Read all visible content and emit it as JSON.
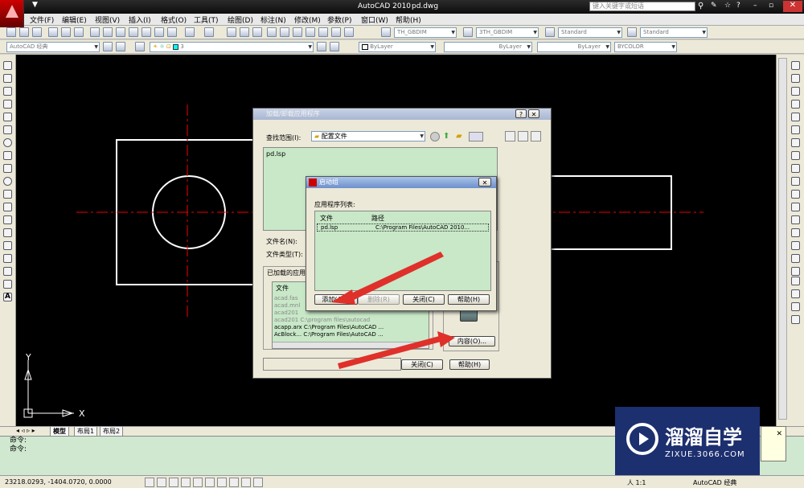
{
  "app": {
    "title": "AutoCAD 2010",
    "file": "pd.dwg"
  },
  "search": {
    "placeholder": "键入关键字或短语"
  },
  "menus": [
    "文件(F)",
    "编辑(E)",
    "视图(V)",
    "插入(I)",
    "格式(O)",
    "工具(T)",
    "绘图(D)",
    "标注(N)",
    "修改(M)",
    "参数(P)",
    "窗口(W)",
    "帮助(H)"
  ],
  "toolbar1": {
    "dimstyle1": "TH_GBDIM",
    "dimstyle2": "3TH_GBDIM",
    "style1": "Standard",
    "style2": "Standard"
  },
  "toolbar2": {
    "workspace": "AutoCAD 经典",
    "layer": "3",
    "color": "ByLayer",
    "linetype": "ByLayer",
    "lineweight": "ByLayer",
    "plotstyle": "BYCOLOR"
  },
  "ucs": {
    "y": "Y",
    "x": "X"
  },
  "layout_tabs": [
    "模型",
    "布局1",
    "布局2"
  ],
  "command": {
    "line1": "命令:",
    "line2": "命令:"
  },
  "status": {
    "coords": "23218.0293,  -1404.0720,  0.0000",
    "scale": "人 1:1",
    "workspace": "AutoCAD 经典"
  },
  "appload": {
    "title": "加载/卸载应用程序",
    "lookin_label": "查找范围(I):",
    "lookin_value": "配置文件",
    "file_item": "pd.lsp",
    "filename_label": "文件名(N):",
    "filetype_label": "文件类型(T):",
    "loaded_group": "已加载的应用",
    "col_file": "文件",
    "loaded_rows": [
      {
        "name": "acad.fas",
        "path": "",
        "gray": true
      },
      {
        "name": "acad.mnl",
        "path": "",
        "gray": true
      },
      {
        "name": "acad201",
        "path": "",
        "gray": true
      },
      {
        "name": "acad201",
        "path": "C:\\program files\\autocad",
        "gray": true
      },
      {
        "name": "acapp.arx",
        "path": "C:\\Program Files\\AutoCAD ...",
        "gray": false
      },
      {
        "name": "AcBlock...",
        "path": "C:\\Program Files\\AutoCAD ...",
        "gray": false
      }
    ],
    "contents_btn": "内容(O)...",
    "close_btn": "关闭(C)",
    "help_btn": "帮助(H)"
  },
  "startup": {
    "title": "启动组",
    "list_label": "应用程序列表:",
    "col_file": "文件",
    "col_path": "路径",
    "row_file": "pd.lsp",
    "row_path": "C:\\Program Files\\AutoCAD 2010...",
    "add_btn": "添加(A)...",
    "remove_btn": "删除(R)",
    "close_btn": "关闭(C)",
    "help_btn": "帮助(H)"
  },
  "watermark": {
    "brand": "溜溜自学",
    "url": "ZIXUE.3066.COM"
  },
  "colors": {
    "canvas": "#000000",
    "arrow": "#e0302a",
    "dialog_list": "#c8e8c8",
    "watermark_bg": "#1c2f6e"
  }
}
